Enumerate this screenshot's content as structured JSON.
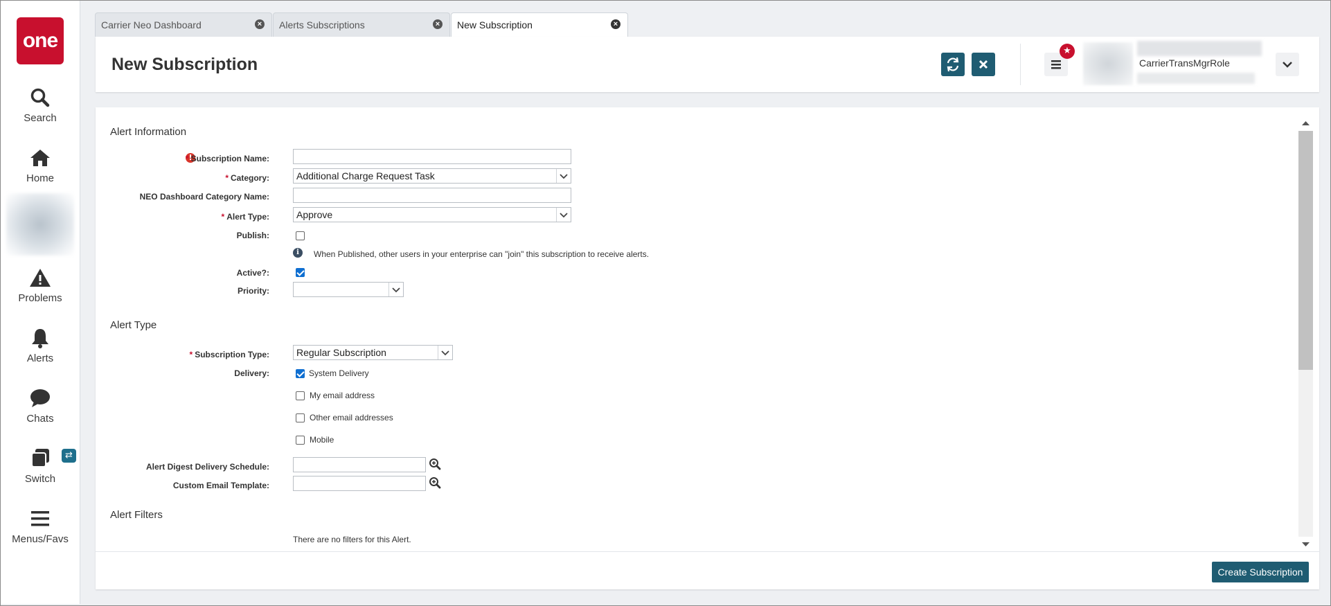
{
  "nav": {
    "logo": "one",
    "items": [
      {
        "label": "Search",
        "icon": "search-icon"
      },
      {
        "label": "Home",
        "icon": "home-icon"
      },
      {
        "label": "Problems",
        "icon": "warning-icon"
      },
      {
        "label": "Alerts",
        "icon": "bell-icon"
      },
      {
        "label": "Chats",
        "icon": "chat-icon"
      },
      {
        "label": "Switch",
        "icon": "switch-icon"
      },
      {
        "label": "Menus/Favs",
        "icon": "menu-icon"
      }
    ],
    "switch_badge": "⇄"
  },
  "tabs": [
    {
      "label": "Carrier Neo Dashboard",
      "active": false
    },
    {
      "label": "Alerts Subscriptions",
      "active": false
    },
    {
      "label": "New Subscription",
      "active": true
    }
  ],
  "header": {
    "title": "New Subscription",
    "user_role": "CarrierTransMgrRole"
  },
  "form": {
    "alert_information": {
      "section_title": "Alert Information",
      "subscription_name": {
        "label": "Subscription Name:",
        "value": ""
      },
      "category": {
        "label": "Category:",
        "value": "Additional Charge Request Task"
      },
      "neo_dashboard_category_name": {
        "label": "NEO Dashboard Category Name:",
        "value": ""
      },
      "alert_type": {
        "label": "Alert Type:",
        "value": "Approve"
      },
      "publish": {
        "label": "Publish:",
        "checked": false
      },
      "publish_note": "When Published, other users in your enterprise can \"join\" this subscription to receive alerts.",
      "active": {
        "label": "Active?:",
        "checked": true
      },
      "priority": {
        "label": "Priority:",
        "value": ""
      }
    },
    "alert_type_section": {
      "section_title": "Alert Type",
      "subscription_type": {
        "label": "Subscription Type:",
        "value": "Regular Subscription"
      },
      "delivery": {
        "label": "Delivery:",
        "options": [
          {
            "label": "System Delivery",
            "checked": true
          },
          {
            "label": "My email address",
            "checked": false
          },
          {
            "label": "Other email addresses",
            "checked": false
          },
          {
            "label": "Mobile",
            "checked": false
          }
        ]
      },
      "alert_digest_delivery_schedule": {
        "label": "Alert Digest Delivery Schedule:",
        "value": ""
      },
      "custom_email_template": {
        "label": "Custom Email Template:",
        "value": ""
      }
    },
    "alert_filters": {
      "section_title": "Alert Filters",
      "empty_message": "There are no filters for this Alert."
    }
  },
  "footer": {
    "create_label": "Create Subscription"
  },
  "colors": {
    "brand_red": "#c8102e",
    "primary_teal": "#1f5c72",
    "checkbox_blue": "#0f6fd1"
  }
}
